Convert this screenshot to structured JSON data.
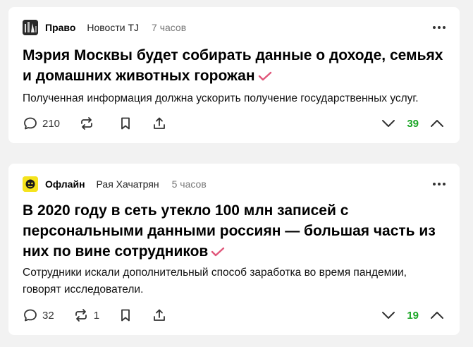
{
  "posts": [
    {
      "source": "Право",
      "author": "Новости TJ",
      "time": "7 часов",
      "title": "Мэрия Москвы будет собирать данные о доходе, семьях и домашних животных горожан",
      "lead": "Полученная информация должна ускорить получение государственных услуг.",
      "comments": "210",
      "reposts": "",
      "score": "39"
    },
    {
      "source": "Офлайн",
      "author": "Рая Хачатрян",
      "time": "5 часов",
      "title": "В 2020 году в сеть утекло 100 млн записей с персональными данными россиян — большая часть из них по вине сотрудников",
      "lead": "Сотрудники искали дополнительный способ заработка во время пандемии, говорят исследователи.",
      "comments": "32",
      "reposts": "1",
      "score": "19"
    }
  ],
  "colors": {
    "background": "#f2f2f2",
    "card": "#ffffff",
    "score_positive": "#1ba626",
    "checkmark": "#e0567a"
  },
  "icons": [
    "comment-icon",
    "repost-icon",
    "bookmark-icon",
    "share-icon",
    "downvote-icon",
    "upvote-icon",
    "more-icon",
    "verified-check-icon"
  ]
}
